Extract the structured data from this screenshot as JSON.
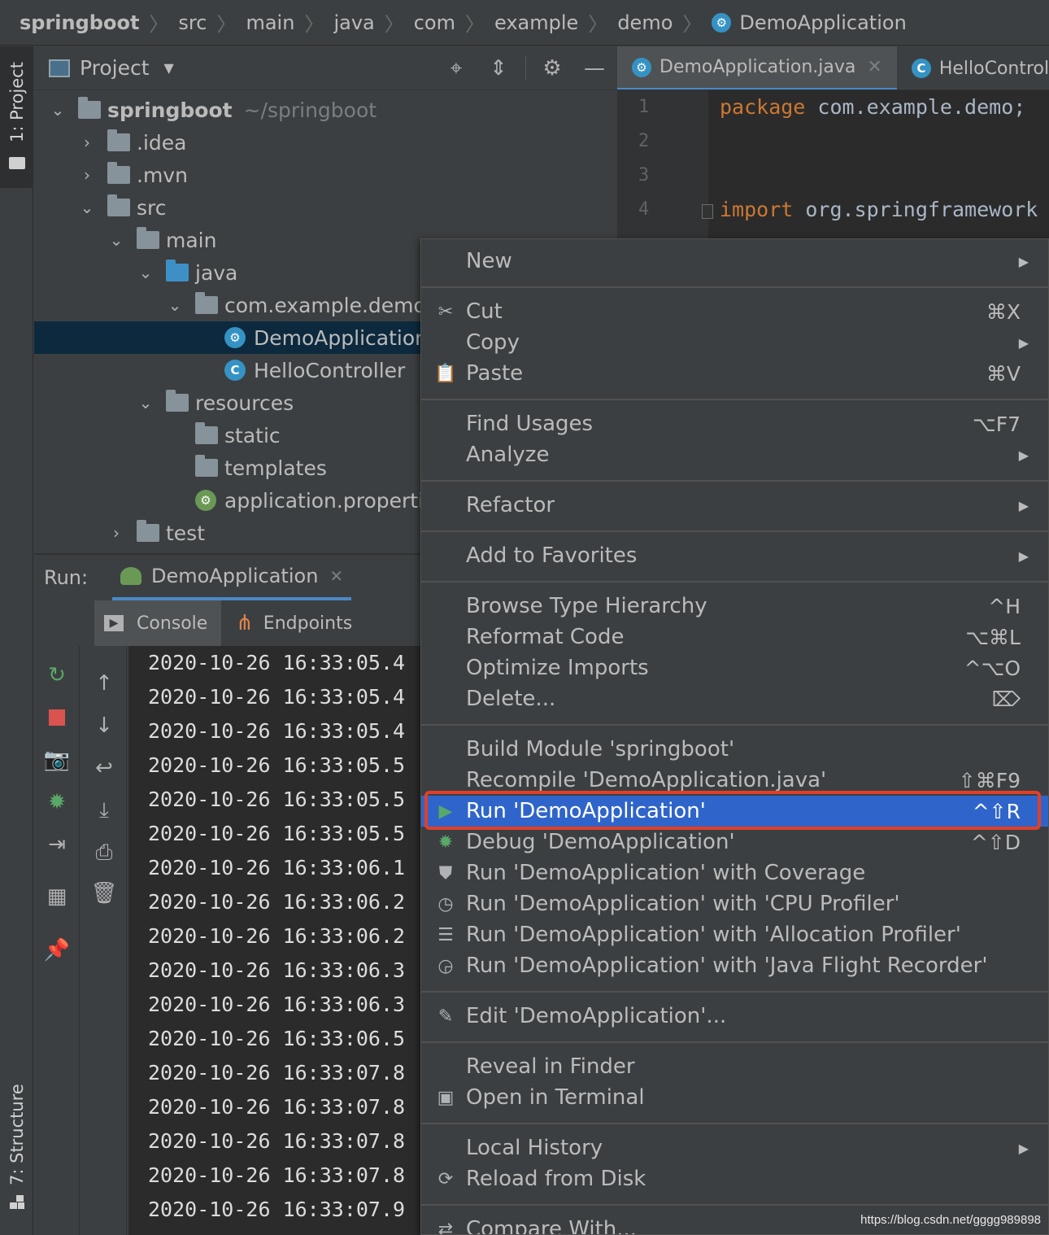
{
  "breadcrumb": [
    "springboot",
    "src",
    "main",
    "java",
    "com",
    "example",
    "demo",
    "DemoApplication"
  ],
  "left_strip": {
    "project_label": "1: Project",
    "structure_label": "7: Structure"
  },
  "project_panel": {
    "title": "Project",
    "tree": [
      {
        "label": "springboot",
        "extra": "~/springboot",
        "expanded": true,
        "icon": "module-folder-icon"
      },
      {
        "label": ".idea",
        "expanded": false,
        "icon": "folder-icon"
      },
      {
        "label": ".mvn",
        "expanded": false,
        "icon": "folder-icon"
      },
      {
        "label": "src",
        "expanded": true,
        "icon": "folder-icon"
      },
      {
        "label": "main",
        "expanded": true,
        "icon": "folder-icon"
      },
      {
        "label": "java",
        "expanded": true,
        "icon": "source-folder-icon"
      },
      {
        "label": "com.example.demo",
        "expanded": true,
        "icon": "package-icon"
      },
      {
        "label": "DemoApplication",
        "icon": "spring-boot-class-icon",
        "selected": true
      },
      {
        "label": "HelloController",
        "icon": "class-icon"
      },
      {
        "label": "resources",
        "expanded": true,
        "icon": "resources-folder-icon"
      },
      {
        "label": "static",
        "icon": "folder-icon"
      },
      {
        "label": "templates",
        "icon": "folder-icon"
      },
      {
        "label": "application.properti",
        "icon": "spring-properties-icon"
      },
      {
        "label": "test",
        "expanded": false,
        "icon": "folder-icon"
      }
    ]
  },
  "editor": {
    "tabs": [
      "DemoApplication.java",
      "HelloControl"
    ],
    "line_numbers": [
      "1",
      "2",
      "3",
      "4"
    ],
    "line1_kw": "package",
    "line1_rest": "com.example.demo;",
    "line4_kw": "import",
    "line4_rest": "org.springframework"
  },
  "run_panel": {
    "label": "Run:",
    "config_tab": "DemoApplication",
    "subtabs": [
      "Console",
      "Endpoints"
    ],
    "log_lines": [
      "2020-10-26 16:33:05.4",
      "2020-10-26 16:33:05.4",
      "2020-10-26 16:33:05.4",
      "2020-10-26 16:33:05.5",
      "2020-10-26 16:33:05.5",
      "2020-10-26 16:33:05.5",
      "2020-10-26 16:33:06.1",
      "2020-10-26 16:33:06.2",
      "2020-10-26 16:33:06.2",
      "2020-10-26 16:33:06.3",
      "2020-10-26 16:33:06.3",
      "2020-10-26 16:33:06.5",
      "2020-10-26 16:33:07.8",
      "2020-10-26 16:33:07.8",
      "2020-10-26 16:33:07.8",
      "2020-10-26 16:33:07.8",
      "2020-10-26 16:33:07.9"
    ]
  },
  "context_menu": {
    "items": [
      {
        "label": "New",
        "submenu": true
      },
      {
        "label": "Cut",
        "shortcut": "⌘X",
        "icon": "scissors-icon"
      },
      {
        "label": "Copy",
        "submenu": true
      },
      {
        "label": "Paste",
        "shortcut": "⌘V",
        "icon": "clipboard-icon"
      },
      {
        "label": "Find Usages",
        "shortcut": "⌥F7"
      },
      {
        "label": "Analyze",
        "submenu": true
      },
      {
        "label": "Refactor",
        "submenu": true
      },
      {
        "label": "Add to Favorites",
        "submenu": true
      },
      {
        "label": "Browse Type Hierarchy",
        "shortcut": "^H"
      },
      {
        "label": "Reformat Code",
        "shortcut": "⌥⌘L"
      },
      {
        "label": "Optimize Imports",
        "shortcut": "^⌥O"
      },
      {
        "label": "Delete...",
        "shortcut": "⌦"
      },
      {
        "label": "Build Module 'springboot'"
      },
      {
        "label": "Recompile 'DemoApplication.java'",
        "shortcut": "⇧⌘F9"
      },
      {
        "label": "Run 'DemoApplication'",
        "shortcut": "^⇧R",
        "icon": "run-icon",
        "highlighted": true
      },
      {
        "label": "Debug 'DemoApplication'",
        "shortcut": "^⇧D",
        "icon": "debug-icon"
      },
      {
        "label": "Run 'DemoApplication' with Coverage",
        "icon": "coverage-icon"
      },
      {
        "label": "Run 'DemoApplication' with 'CPU Profiler'",
        "icon": "cpu-profiler-icon"
      },
      {
        "label": "Run 'DemoApplication' with 'Allocation Profiler'",
        "icon": "allocation-profiler-icon"
      },
      {
        "label": "Run 'DemoApplication' with 'Java Flight Recorder'",
        "icon": "flight-recorder-icon"
      },
      {
        "label": "Edit 'DemoApplication'...",
        "icon": "edit-config-icon"
      },
      {
        "label": "Reveal in Finder"
      },
      {
        "label": "Open in Terminal",
        "icon": "terminal-icon"
      },
      {
        "label": "Local History",
        "submenu": true
      },
      {
        "label": "Reload from Disk",
        "icon": "reload-icon"
      },
      {
        "label": "Compare With...",
        "icon": "compare-icon"
      }
    ]
  },
  "watermark": "https://blog.csdn.net/gggg989898",
  "colors": {
    "accent": "#2f65ca",
    "highlight_box": "#e0402a",
    "keyword": "#cc7832",
    "selection": "#0d293e"
  }
}
